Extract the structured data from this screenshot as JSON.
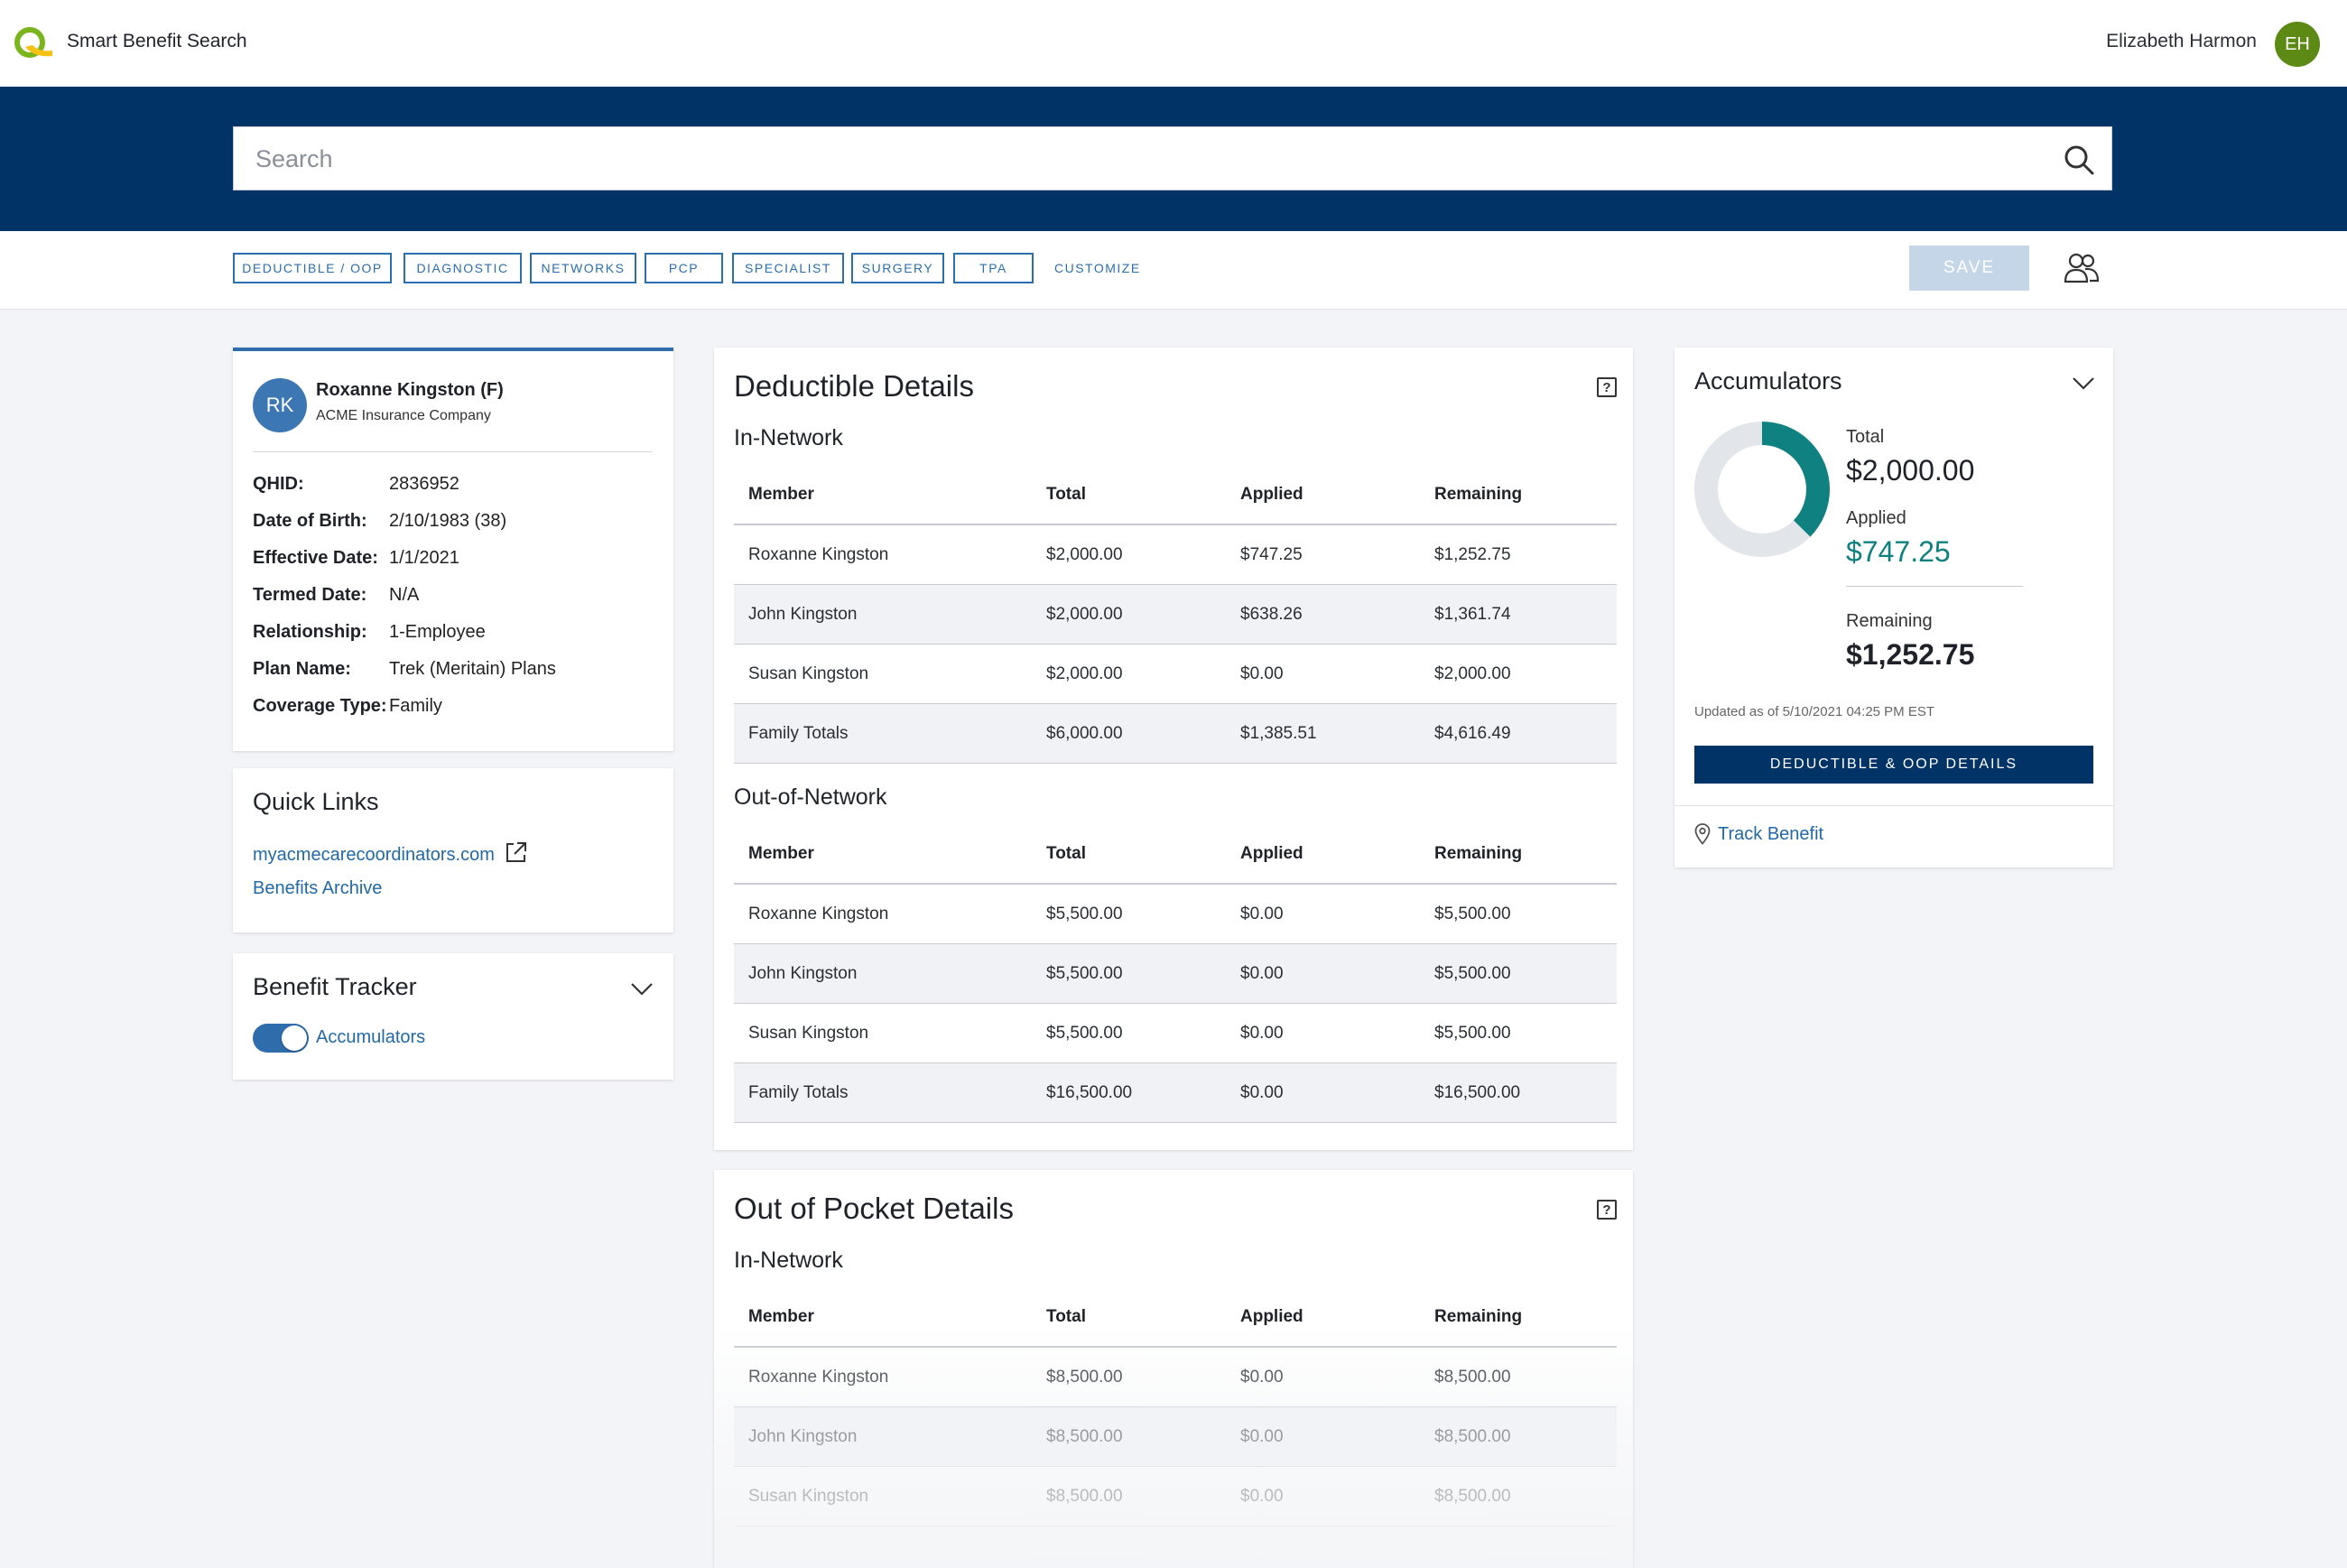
{
  "app": {
    "title": "Smart Benefit Search"
  },
  "user": {
    "name": "Elizabeth Harmon",
    "initials": "EH"
  },
  "search": {
    "placeholder": "Search"
  },
  "filters": {
    "chips": [
      "DEDUCTIBLE / OOP",
      "DIAGNOSTIC",
      "NETWORKS",
      "PCP",
      "SPECIALIST",
      "SURGERY",
      "TPA"
    ],
    "customize_label": "CUSTOMIZE",
    "save_label": "SAVE"
  },
  "member": {
    "initials": "RK",
    "name": "Roxanne Kingston (F)",
    "company": "ACME Insurance Company",
    "fields": [
      {
        "label": "QHID:",
        "value": "2836952"
      },
      {
        "label": "Date of Birth:",
        "value": "2/10/1983 (38)"
      },
      {
        "label": "Effective Date:",
        "value": "1/1/2021"
      },
      {
        "label": "Termed Date:",
        "value": "N/A"
      },
      {
        "label": "Relationship:",
        "value": "1-Employee"
      },
      {
        "label": "Plan Name:",
        "value": "Trek (Meritain) Plans"
      },
      {
        "label": "Coverage Type:",
        "value": "Family"
      }
    ]
  },
  "quick_links": {
    "title": "Quick Links",
    "items": [
      "myacmecarecoordinators.com",
      "Benefits Archive"
    ]
  },
  "benefit_tracker": {
    "title": "Benefit Tracker",
    "toggle_label": "Accumulators",
    "toggle_on": true
  },
  "deductible": {
    "title": "Deductible Details",
    "columns": [
      "Member",
      "Total",
      "Applied",
      "Remaining"
    ],
    "in_network": {
      "title": "In-Network",
      "rows": [
        [
          "Roxanne Kingston",
          "$2,000.00",
          "$747.25",
          "$1,252.75"
        ],
        [
          "John Kingston",
          "$2,000.00",
          "$638.26",
          "$1,361.74"
        ],
        [
          "Susan Kingston",
          "$2,000.00",
          "$0.00",
          "$2,000.00"
        ],
        [
          "Family Totals",
          "$6,000.00",
          "$1,385.51",
          "$4,616.49"
        ]
      ]
    },
    "out_of_network": {
      "title": "Out-of-Network",
      "rows": [
        [
          "Roxanne Kingston",
          "$5,500.00",
          "$0.00",
          "$5,500.00"
        ],
        [
          "John Kingston",
          "$5,500.00",
          "$0.00",
          "$5,500.00"
        ],
        [
          "Susan Kingston",
          "$5,500.00",
          "$0.00",
          "$5,500.00"
        ],
        [
          "Family Totals",
          "$16,500.00",
          "$0.00",
          "$16,500.00"
        ]
      ]
    }
  },
  "oop": {
    "title": "Out of Pocket Details",
    "columns": [
      "Member",
      "Total",
      "Applied",
      "Remaining"
    ],
    "in_network": {
      "title": "In-Network",
      "rows": [
        [
          "Roxanne Kingston",
          "$8,500.00",
          "$0.00",
          "$8,500.00"
        ],
        [
          "John Kingston",
          "$8,500.00",
          "$0.00",
          "$8,500.00"
        ],
        [
          "Susan Kingston",
          "$8,500.00",
          "$0.00",
          "$8,500.00"
        ]
      ]
    }
  },
  "accumulators": {
    "title": "Accumulators",
    "total_label": "Total",
    "total": "$2,000.00",
    "applied_label": "Applied",
    "applied": "$747.25",
    "remaining_label": "Remaining",
    "remaining": "$1,252.75",
    "applied_fraction": 0.3736,
    "updated": "Updated as of 5/10/2021 04:25 PM EST",
    "button": "DEDUCTIBLE & OOP DETAILS",
    "track_link": "Track Benefit",
    "colors": {
      "applied": "#0f8180",
      "track": "#e2e5e9"
    }
  },
  "icons": {
    "logo": "smart-benefit-logo",
    "search": "search-icon",
    "people": "people-icon",
    "external_link": "external-link-icon",
    "chevron": "chevron-down-icon",
    "help": "help-icon",
    "pin": "location-pin-icon"
  },
  "colors": {
    "brand_navy": "#023366",
    "link_blue": "#2169a8",
    "teal": "#0f8180",
    "avatar_green": "#5c8a14"
  }
}
